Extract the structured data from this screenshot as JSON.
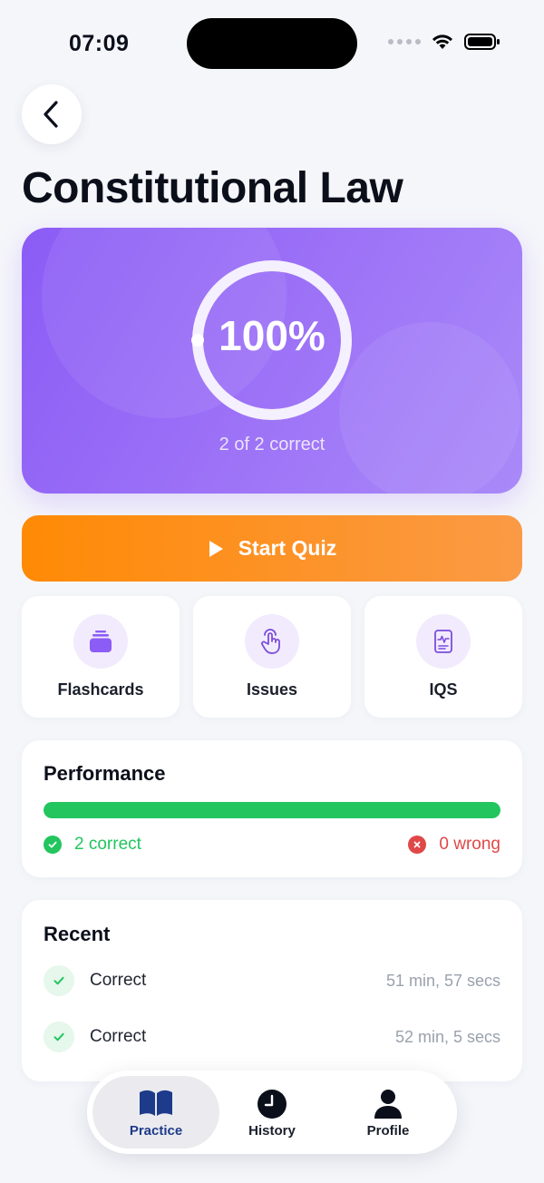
{
  "status": {
    "time": "07:09"
  },
  "page": {
    "title": "Constitutional Law"
  },
  "score": {
    "percent_label": "100%",
    "percent": 100,
    "subtitle": "2 of 2 correct"
  },
  "start_button": {
    "label": "Start Quiz"
  },
  "tools": [
    {
      "label": "Flashcards",
      "icon": "cards-stack-icon"
    },
    {
      "label": "Issues",
      "icon": "tap-hand-icon"
    },
    {
      "label": "IQS",
      "icon": "document-pulse-icon"
    }
  ],
  "performance": {
    "title": "Performance",
    "correct_fraction": 1.0,
    "correct_label": "2 correct",
    "wrong_label": "0 wrong",
    "colors": {
      "correct": "#22c55e",
      "wrong": "#e04848"
    }
  },
  "recent": {
    "title": "Recent",
    "items": [
      {
        "result": "Correct",
        "duration": "51 min, 57 secs"
      },
      {
        "result": "Correct",
        "duration": "52 min, 5 secs"
      }
    ]
  },
  "tabbar": {
    "items": [
      {
        "label": "Practice",
        "icon": "book-icon",
        "active": true
      },
      {
        "label": "History",
        "icon": "clock-icon",
        "active": false
      },
      {
        "label": "Profile",
        "icon": "person-icon",
        "active": false
      }
    ]
  },
  "colors": {
    "accent": "#8b5cf6",
    "cta": "#ff8a05",
    "tab_active": "#1e3a8a"
  }
}
